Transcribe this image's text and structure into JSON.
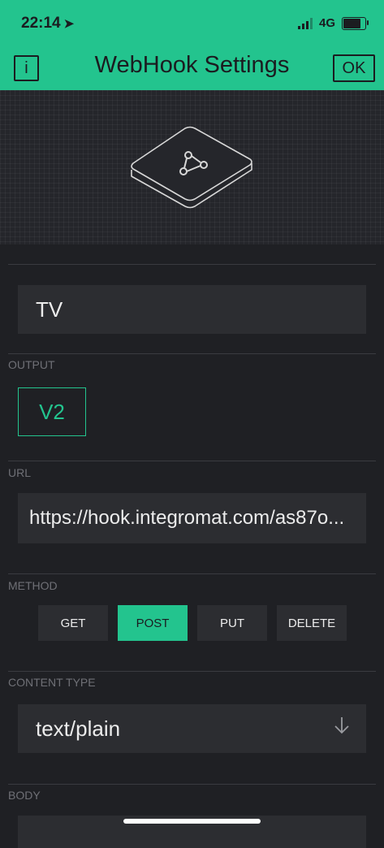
{
  "status_bar": {
    "time": "22:14",
    "location_arrow": "➤",
    "network": "4G",
    "battery_level": 0.8
  },
  "header": {
    "info_label": "i",
    "title": "WebHook Settings",
    "ok_label": "OK"
  },
  "widget_name": "TV",
  "output": {
    "label": "OUTPUT",
    "pin": "V2"
  },
  "url": {
    "label": "URL",
    "value": "https://hook.integromat.com/as87o..."
  },
  "method": {
    "label": "METHOD",
    "options": [
      "GET",
      "POST",
      "PUT",
      "DELETE"
    ],
    "selected": "POST"
  },
  "content_type": {
    "label": "CONTENT TYPE",
    "value": "text/plain"
  },
  "body": {
    "label": "BODY"
  },
  "colors": {
    "accent": "#23c48e",
    "background": "#1f2024",
    "field": "#2c2d31"
  },
  "icons": {
    "widget_icon": "webhook-icon",
    "dropdown_icon": "arrow-down-icon"
  }
}
